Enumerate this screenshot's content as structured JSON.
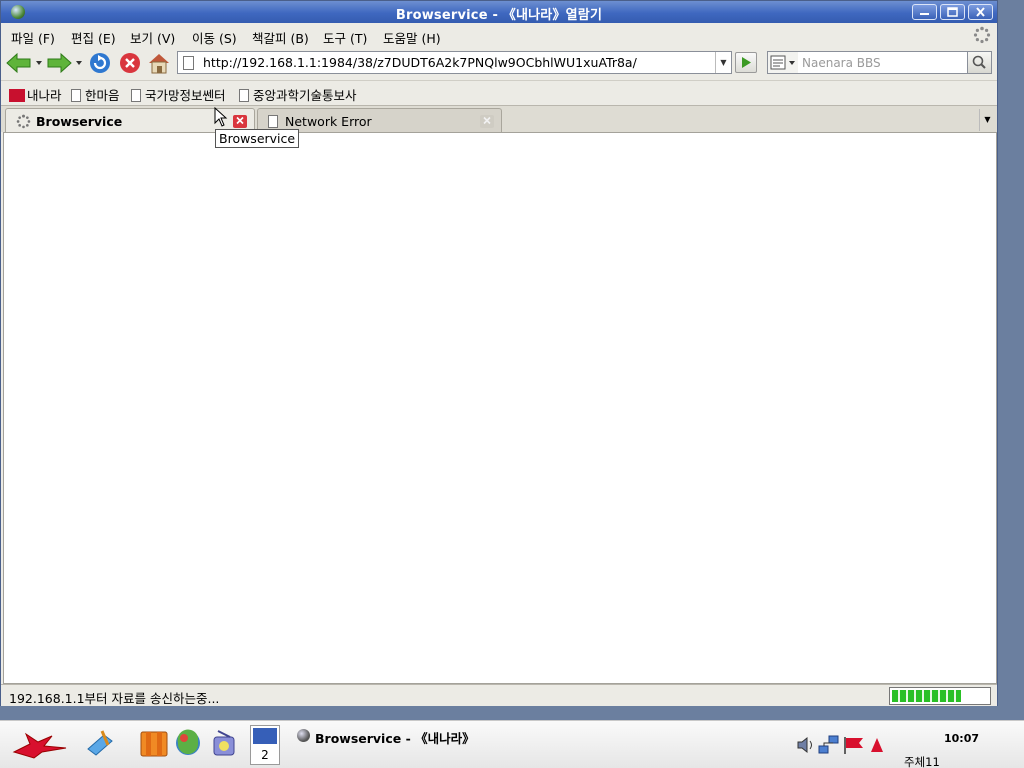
{
  "window": {
    "title": "Browservice - 《내나라》열람기"
  },
  "menu": {
    "items": [
      {
        "label": "파일 (F)"
      },
      {
        "label": "편집 (E)"
      },
      {
        "label": "보기 (V)"
      },
      {
        "label": "이동 (S)"
      },
      {
        "label": "책갈피 (B)"
      },
      {
        "label": "도구 (T)"
      },
      {
        "label": "도움말 (H)"
      }
    ]
  },
  "navigation": {
    "url": "http://192.168.1.1:1984/38/z7DUDT6A2k7PNQlw9OCbhlWU1xuATr8a/",
    "search_placeholder": "Naenara BBS"
  },
  "bookmarks": {
    "items": [
      {
        "label": "내나라"
      },
      {
        "label": "한마음"
      },
      {
        "label": "국가망정보쎈터"
      },
      {
        "label": "중앙과학기술통보사"
      }
    ]
  },
  "tabs": [
    {
      "label": "Browservice",
      "active": true
    },
    {
      "label": "Network Error",
      "active": false
    }
  ],
  "tooltip": {
    "text": "Browservice"
  },
  "status": {
    "text": "192.168.1.1부터 자료를 송신하는중...",
    "progress": 0.72
  },
  "taskbar": {
    "workspace_number": "2",
    "task_label": "Browservice - 《내나라》",
    "clock": "10:07",
    "date": "주체11"
  },
  "colors": {
    "titlebar": "#3f68c0",
    "progress": "#29c025",
    "tab_close_active": "#d9363e"
  }
}
